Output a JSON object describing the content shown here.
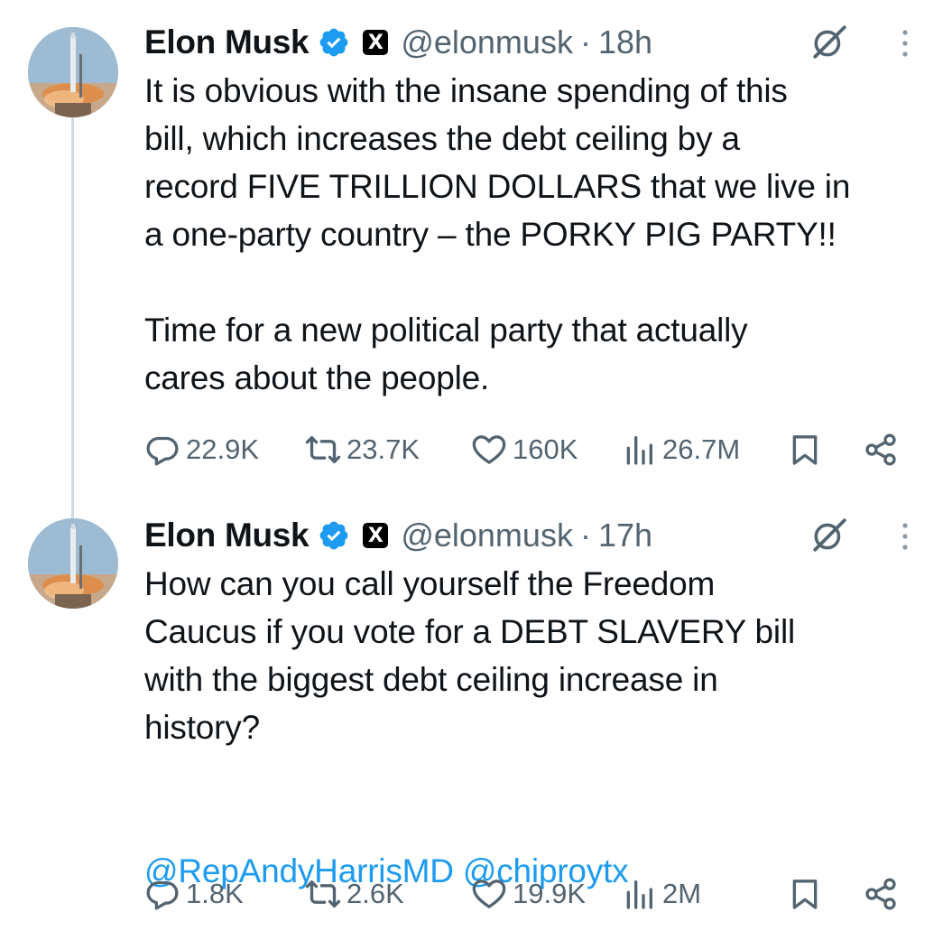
{
  "tweets": [
    {
      "name": "Elon Musk",
      "affiliate_badge": "X",
      "handle": "@elonmusk",
      "separator": "·",
      "time": "18h",
      "body": [
        "It is obvious with the insane spending of this",
        "bill, which increases the debt ceiling by a",
        "record FIVE TRILLION DOLLARS that we live in",
        "a one-party country – the PORKY PIG PARTY!!",
        "",
        "Time for a new political party that actually",
        "cares about the people."
      ],
      "mentions": "",
      "stats": {
        "replies": "22.9K",
        "reposts": "23.7K",
        "likes": "160K",
        "views": "26.7M"
      }
    },
    {
      "name": "Elon Musk",
      "affiliate_badge": "X",
      "handle": "@elonmusk",
      "separator": "·",
      "time": "17h",
      "body": [
        "How can you call yourself the Freedom",
        "Caucus if you vote for a DEBT SLAVERY bill",
        "with the biggest debt ceiling increase in",
        "history?",
        "",
        ""
      ],
      "mentions": "@RepAndyHarrisMD @chiproytx",
      "stats": {
        "replies": "1.8K",
        "reposts": "2.6K",
        "likes": "19.9K",
        "views": "2M"
      }
    }
  ],
  "icons": {
    "verified": "verified-badge-icon",
    "affiliate": "x-logo-icon",
    "grok": "grok-icon",
    "more": "more-vertical-icon",
    "reply": "reply-icon",
    "repost": "repost-icon",
    "like": "heart-icon",
    "views": "views-icon",
    "bookmark": "bookmark-icon",
    "share": "share-icon"
  },
  "colors": {
    "text": "#0f1419",
    "secondary": "#536471",
    "accent": "#1d9bf0",
    "thread_line": "#cfd9de"
  }
}
